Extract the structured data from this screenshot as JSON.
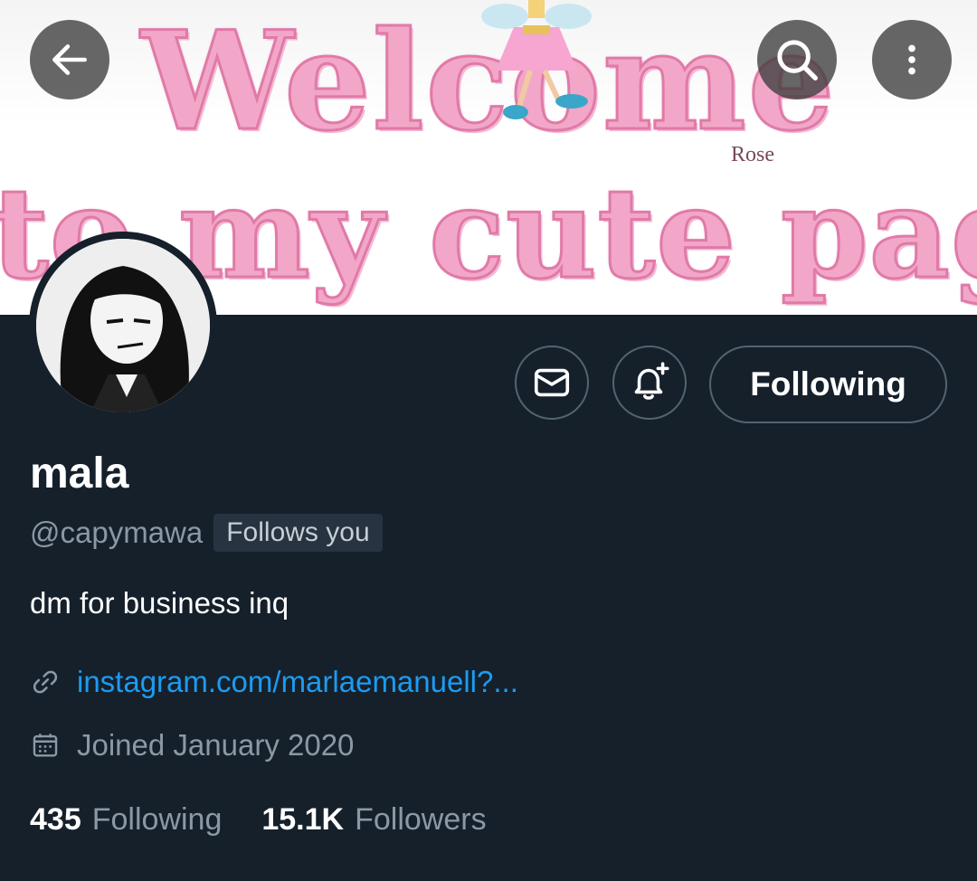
{
  "banner": {
    "line1": "Welcome",
    "line2": "to my cute page",
    "signature": "Rose"
  },
  "icons": {
    "back": "arrow-left-icon",
    "search": "search-icon",
    "more": "more-vertical-icon",
    "message": "envelope-icon",
    "notify": "bell-plus-icon",
    "link": "link-icon",
    "calendar": "calendar-icon"
  },
  "profile": {
    "display_name": "mala",
    "handle": "@capymawa",
    "follows_you": "Follows you",
    "bio": "dm for business inq",
    "link": "instagram.com/marlaemanuell?...",
    "joined": "Joined January 2020"
  },
  "actions": {
    "following_label": "Following"
  },
  "stats": {
    "following_count": "435",
    "following_label": "Following",
    "followers_count": "15.1K",
    "followers_label": "Followers"
  },
  "colors": {
    "background": "#15202b",
    "accent": "#1d9bf0",
    "secondary_text": "#8b98a5",
    "banner_pink": "#f2a7c8"
  }
}
